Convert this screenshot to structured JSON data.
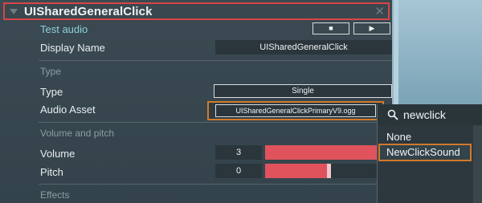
{
  "component": {
    "title": "UISharedGeneralClick",
    "close_glyph": "✕"
  },
  "test_audio": {
    "label": "Test audio",
    "stop_glyph": "■",
    "play_glyph": "▶"
  },
  "fields": {
    "display_name_label": "Display Name",
    "display_name_value": "UISharedGeneralClick",
    "type_section": "Type",
    "type_label": "Type",
    "type_value": "Single",
    "audio_asset_label": "Audio Asset",
    "audio_asset_value": "UISharedGeneralClickPrimaryV9.ogg",
    "volume_section": "Volume and pitch",
    "volume_label": "Volume",
    "volume_value": "3",
    "pitch_label": "Pitch",
    "pitch_value": "0",
    "effects_section": "Effects"
  },
  "sliders": {
    "volume_fraction": 1.0,
    "pitch_fraction": 0.5
  },
  "dropdown": {
    "search_icon": "search-icon",
    "query": "newclick",
    "options": [
      "None",
      "NewClickSound"
    ],
    "selected": "NewClickSound"
  },
  "colors": {
    "highlight_red": "#d64545",
    "highlight_orange": "#d17a2a",
    "slider_fill": "#e0535c",
    "accent_link": "#8bd0dc"
  }
}
